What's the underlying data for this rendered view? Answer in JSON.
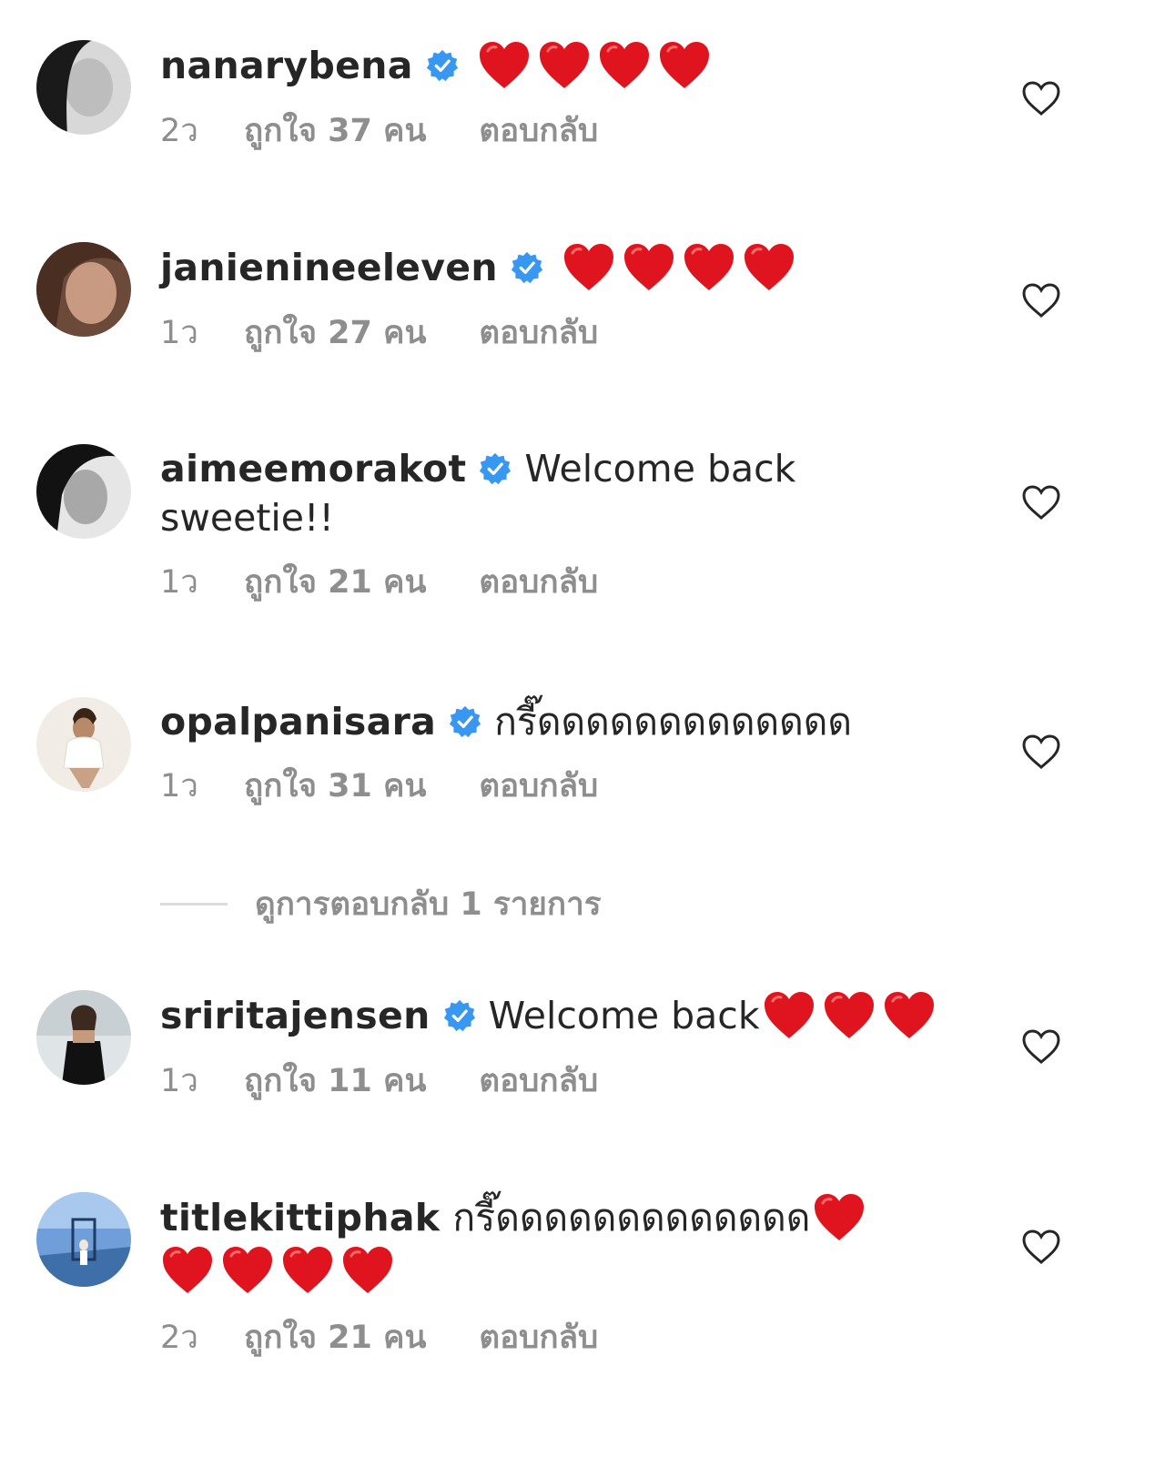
{
  "colors": {
    "verified": "#3897f0",
    "heart": "#e0141e",
    "meta": "#8e8e8e",
    "text": "#262626"
  },
  "icons": {
    "verified": "verified-badge-icon",
    "heart_emoji": "red-heart-emoji",
    "like": "heart-outline-icon"
  },
  "comments": [
    {
      "username": "nanarybena",
      "text": "",
      "text2": "",
      "heart_count_line1": 4,
      "heart_count_line2": 0,
      "time": "2ว",
      "likes": "ถูกใจ 37 คน",
      "reply": "ตอบกลับ"
    },
    {
      "username": "janienineeleven",
      "text": "",
      "text2": "",
      "heart_count_line1": 4,
      "heart_count_line2": 0,
      "time": "1ว",
      "likes": "ถูกใจ 27 คน",
      "reply": "ตอบกลับ"
    },
    {
      "username": "aimeemorakot",
      "text": "Welcome back",
      "text2": "sweetie!!",
      "heart_count_line1": 0,
      "heart_count_line2": 0,
      "time": "1ว",
      "likes": "ถูกใจ 21 คน",
      "reply": "ตอบกลับ"
    },
    {
      "username": "opalpanisara",
      "text": "กรี๊ดดดดดดดดดดดดด",
      "text2": "",
      "heart_count_line1": 0,
      "heart_count_line2": 0,
      "time": "1ว",
      "likes": "ถูกใจ 31 คน",
      "reply": "ตอบกลับ"
    },
    {
      "username": "sriritajensen",
      "text": "Welcome back",
      "text2": "",
      "heart_count_line1": 3,
      "heart_count_line2": 0,
      "time": "1ว",
      "likes": "ถูกใจ 11 คน",
      "reply": "ตอบกลับ"
    },
    {
      "username": "titlekittiphak",
      "text": "กรี๊ดดดดดดดดดดดดด",
      "text2": "",
      "heart_count_line1": 1,
      "heart_count_line2": 4,
      "time": "2ว",
      "likes": "ถูกใจ 21 คน",
      "reply": "ตอบกลับ"
    }
  ],
  "view_replies": "ดูการตอบกลับ 1 รายการ"
}
